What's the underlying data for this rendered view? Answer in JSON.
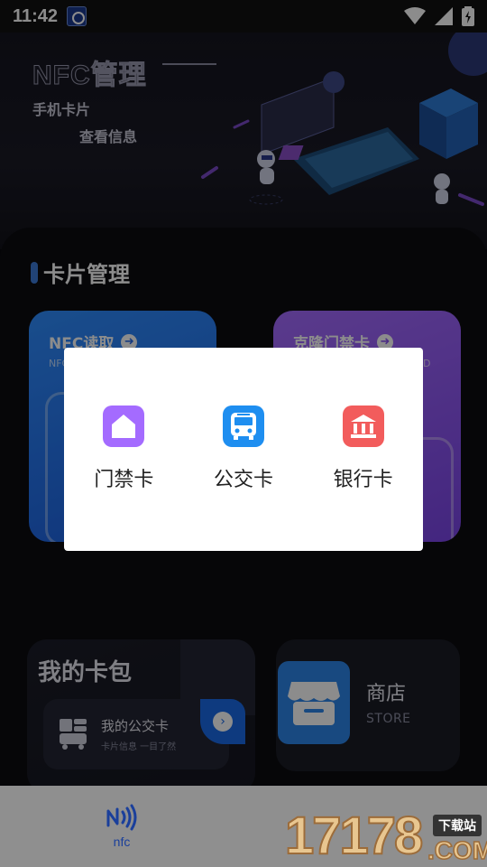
{
  "status_bar": {
    "time": "11:42"
  },
  "header": {
    "title": "NFC管理",
    "subtitle_1": "手机卡片",
    "subtitle_2": "查看信息"
  },
  "section": {
    "title": "卡片管理"
  },
  "cards": [
    {
      "title": "NFC读取",
      "subtitle": "NFC",
      "color": "#2f8dff"
    },
    {
      "title": "克隆门禁卡",
      "subtitle": "D",
      "color": "#9a62ff"
    }
  ],
  "wallet": {
    "title": "我的卡包",
    "item_title": "我的公交卡",
    "item_subtitle": "卡片信息 一目了然"
  },
  "store": {
    "title": "商店",
    "subtitle": "STORE"
  },
  "dialog": {
    "options": [
      {
        "label": "门禁卡",
        "icon": "home-icon",
        "color": "#a46bff"
      },
      {
        "label": "公交卡",
        "icon": "bus-icon",
        "color": "#1e8ef0"
      },
      {
        "label": "银行卡",
        "icon": "bank-icon",
        "color": "#f25c5c"
      }
    ]
  },
  "bottom_nav": {
    "items": [
      {
        "label": "nfc",
        "icon": "nfc-icon"
      }
    ]
  },
  "watermark": {
    "number": "17178",
    "badge": "下载站",
    "suffix": ".COM"
  }
}
